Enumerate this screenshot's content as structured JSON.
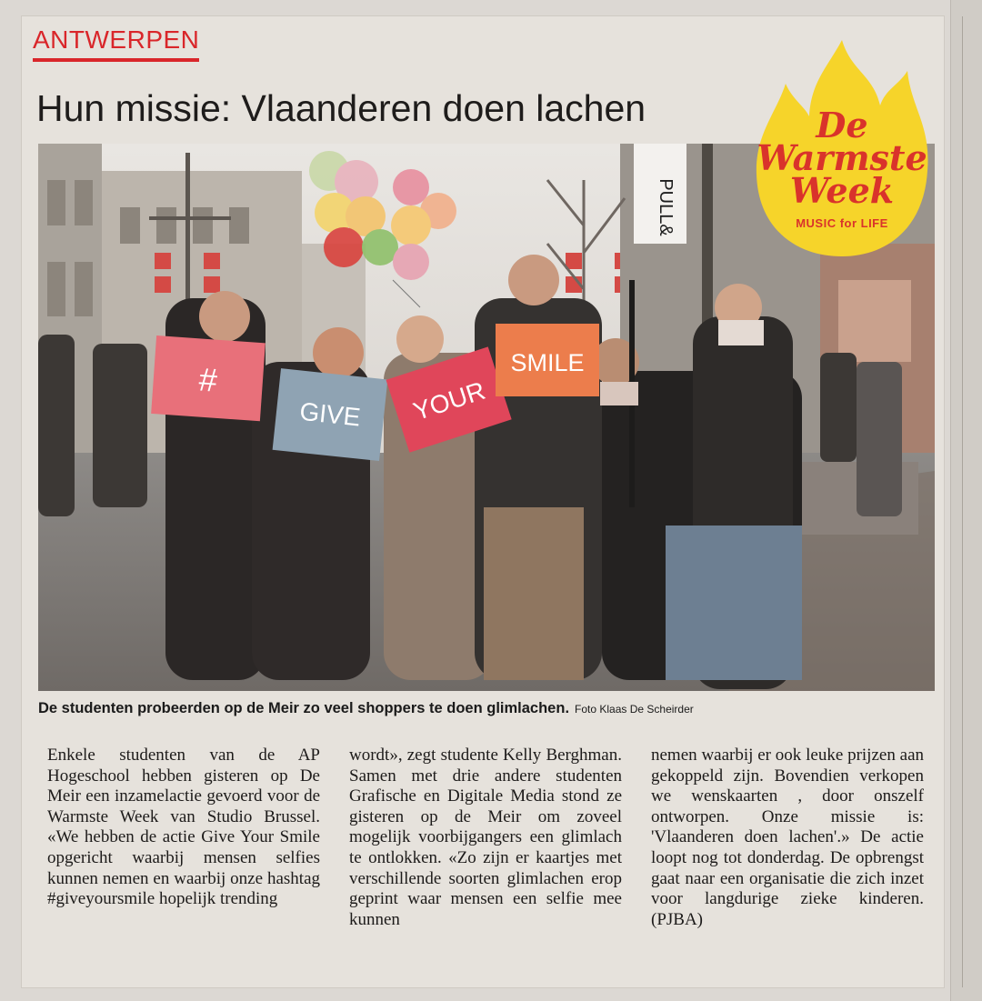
{
  "section": "ANTWERPEN",
  "headline": "Hun missie: Vlaanderen doen lachen",
  "badge": {
    "line1": "De",
    "line2": "Warmste",
    "line3": "Week",
    "tagline": "MUSIC for LIFE"
  },
  "photo": {
    "store_sign": "PULL&",
    "signs": [
      "#",
      "GIVE",
      "YOUR",
      "SMILE"
    ]
  },
  "caption": {
    "text": "De studenten probeerden op de Meir zo veel shoppers te doen glimlachen.",
    "credit": "Foto Klaas De Scheirder"
  },
  "body": {
    "col1": "Enkele studenten van de AP Hogeschool hebben gisteren op De Meir een inzamelactie gevoerd voor de Warmste Week van Studio Brussel. «We hebben de actie Give Your Smile opgericht waarbij mensen selfies kunnen nemen en waarbij onze hashtag #giveyoursmile hopelijk trending",
    "col2": "wordt», zegt studente Kelly Berghman. Samen met drie andere studenten Grafische en Digitale Media stond ze gisteren op de Meir om zoveel mogelijk voorbijgangers een glimlach te ontlokken. «Zo zijn er kaartjes met verschillende soorten glimlachen erop geprint waar mensen een selfie mee kunnen",
    "col3": "nemen waarbij er ook leuke prijzen aan gekoppeld zijn. Bovendien verkopen we wenskaarten , door onszelf ontworpen. Onze missie is: 'Vlaanderen doen lachen'.» De actie loopt nog tot donderdag. De opbrengst gaat naar een organisatie die zich inzet voor langdurige zieke kinderen. (PJBA)"
  },
  "colors": {
    "accent": "#d9262a",
    "badge_yellow": "#f6d42a",
    "sign_pink": "#e8707a",
    "sign_grey": "#8fa3b3",
    "sign_red": "#e0465a",
    "sign_orange": "#ec7d4c"
  }
}
